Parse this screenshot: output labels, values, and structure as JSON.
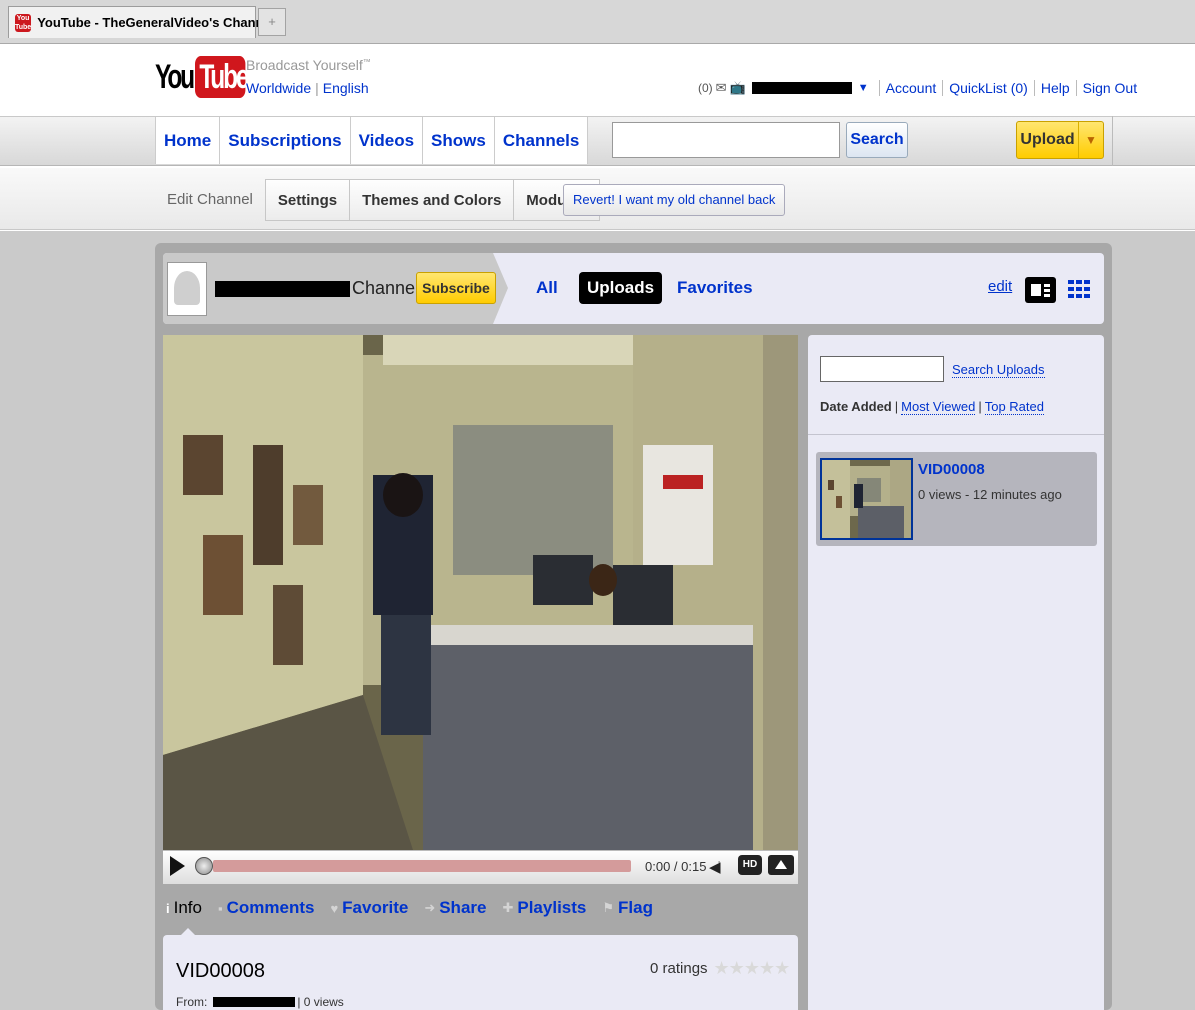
{
  "browser": {
    "tab_title": "YouTube - TheGeneralVideo's Channel",
    "favicon_text": "You Tube",
    "new_tab_glyph": "+"
  },
  "header": {
    "logo_you": "You",
    "logo_tube": "Tube",
    "tagline": "Broadcast Yourself",
    "tagline_tm": "™",
    "worldwide": "Worldwide",
    "language": "English",
    "inbox_count": "(0)",
    "account": "Account",
    "quicklist": "QuickList (0)",
    "help": "Help",
    "sign_out": "Sign Out"
  },
  "nav": {
    "items": [
      "Home",
      "Subscriptions",
      "Videos",
      "Shows",
      "Channels"
    ],
    "search_placeholder": "",
    "search_label": "Search",
    "upload_label": "Upload"
  },
  "edit_bar": {
    "current": "Edit Channel",
    "tabs": [
      "Settings",
      "Themes and Colors",
      "Modules"
    ],
    "revert": "Revert! I want my old channel back"
  },
  "channel": {
    "name_suffix": "Channel",
    "subscribe": "Subscribe",
    "filters": [
      "All",
      "Uploads",
      "Favorites"
    ],
    "active_filter": "Uploads",
    "edit": "edit"
  },
  "player": {
    "time": "0:00 / 0:15",
    "hd_label": "HD",
    "progress": 0
  },
  "info_tabs": {
    "items": [
      "Info",
      "Comments",
      "Favorite",
      "Share",
      "Playlists",
      "Flag"
    ]
  },
  "video_info": {
    "title": "VID00008",
    "ratings": "0 ratings",
    "stars": "★★★★★",
    "from_label": "From:",
    "views": "| 0 views"
  },
  "uploads": {
    "search_value": "",
    "search_label": "Search Uploads",
    "sort_date": "Date Added",
    "sort_viewed": "Most Viewed",
    "sort_rated": "Top Rated",
    "items": [
      {
        "title": "VID00008",
        "meta": "0 views - 12 minutes ago"
      }
    ]
  },
  "colors": {
    "link": "#0033cc",
    "brand_red": "#d0171d",
    "upload_yellow": "#ffcc00"
  }
}
